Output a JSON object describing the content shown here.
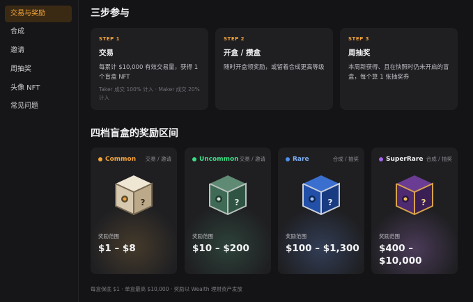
{
  "sidebar": {
    "items": [
      {
        "label": "交易与奖励",
        "active": true
      },
      {
        "label": "合成",
        "active": false
      },
      {
        "label": "邀请",
        "active": false
      },
      {
        "label": "周抽奖",
        "active": false
      },
      {
        "label": "头像 NFT",
        "active": false
      },
      {
        "label": "常见问题",
        "active": false
      }
    ]
  },
  "steps_section": {
    "title": "三步参与",
    "steps": [
      {
        "label": "STEP 1",
        "title": "交易",
        "desc": "每累计 $10,000 有效交易量，获得 1 个盲盒 NFT",
        "note": "Taker 成交 100% 计入 · Maker 成交 20% 计入"
      },
      {
        "label": "STEP 2",
        "title": "开盒 / 攒盒",
        "desc": "随时开盒领奖励，或留着合成更高等级",
        "note": ""
      },
      {
        "label": "STEP 3",
        "title": "周抽奖",
        "desc": "本周新获得、且在快照时仍未开启的盲盒，每个算 1 张抽奖券",
        "note": ""
      }
    ]
  },
  "boxes_section": {
    "title": "四档盲盒的奖励区间",
    "boxes": [
      {
        "tier": "Common",
        "sub": "交易 / 邀请",
        "range_label": "奖励范围",
        "range": "$1 – $8",
        "color": "#f2a33a",
        "icon": "common-box-icon"
      },
      {
        "tier": "Uncommon",
        "sub": "交易 / 邀请",
        "range_label": "奖励范围",
        "range": "$10 – $200",
        "color": "#3ddc84",
        "icon": "uncommon-box-icon"
      },
      {
        "tier": "Rare",
        "sub": "合成 / 抽奖",
        "range_label": "奖励范围",
        "range": "$100 – $1,300",
        "color": "#4d8ff0",
        "icon": "rare-box-icon"
      },
      {
        "tier": "SuperRare",
        "sub": "合成 / 抽奖",
        "range_label": "奖励范围",
        "range": "$400 – $10,000",
        "color": "#a565f0",
        "icon": "superrare-box-icon"
      }
    ]
  },
  "footer": {
    "text": "每盒保底 $1 · 单盒最高 $10,000 · 奖励以 Wealth 理财资产发放"
  },
  "colors": {
    "accent": "#f2a33a",
    "background": "#141416",
    "card": "#1f1f22"
  }
}
